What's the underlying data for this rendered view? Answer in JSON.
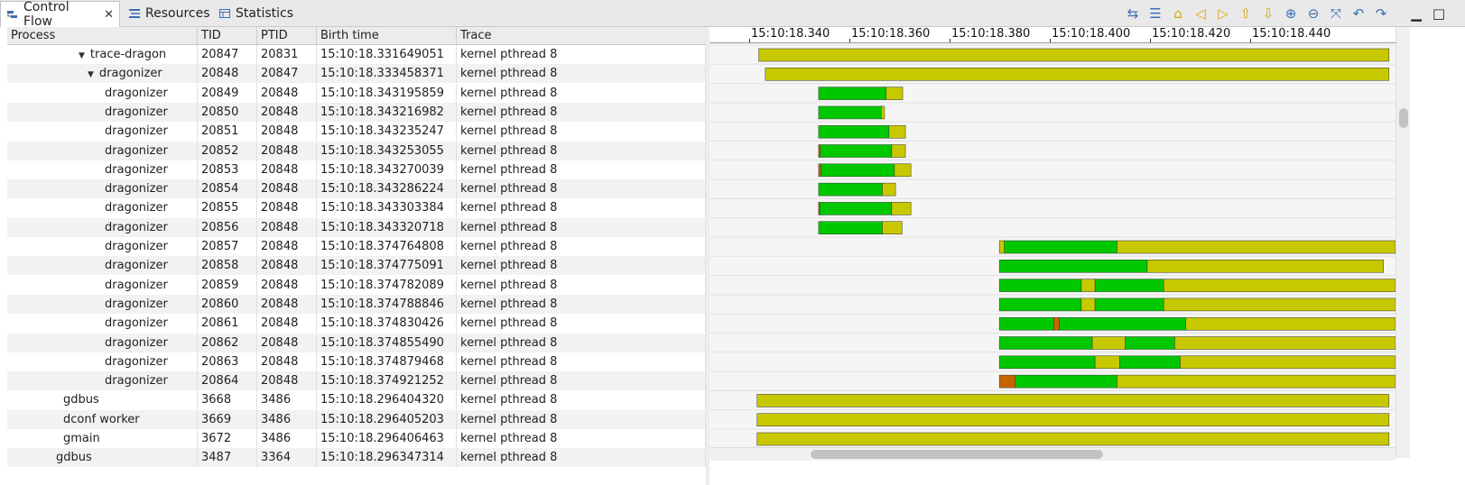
{
  "tabs": [
    {
      "label": "Control Flow",
      "icon": "control-flow-icon",
      "active": true,
      "closable": true
    },
    {
      "label": "Resources",
      "icon": "resources-icon",
      "active": false
    },
    {
      "label": "Statistics",
      "icon": "statistics-icon",
      "active": false
    }
  ],
  "toolbar": [
    "align-views-icon",
    "show-legend-icon",
    "reset-timescale-icon",
    "select-previous-event-icon",
    "select-next-event-icon",
    "previous-process-icon",
    "next-process-icon",
    "zoom-in-icon",
    "zoom-out-icon",
    "hide-arrows-icon",
    "follow-arrow-backward-icon",
    "follow-arrow-forward-icon",
    "minimize-icon",
    "maximize-icon"
  ],
  "table": {
    "headers": [
      "Process",
      "TID",
      "PTID",
      "Birth time",
      "Trace"
    ],
    "rows": [
      {
        "process": "trace-dragon",
        "tid": "20847",
        "ptid": "20831",
        "birth": "15:10:18.331649051",
        "trace": "kernel pthread 8",
        "expander": "▼"
      },
      {
        "process": "dragonizer",
        "tid": "20848",
        "ptid": "20847",
        "birth": "15:10:18.333458371",
        "trace": "kernel pthread 8",
        "expander": "▼"
      },
      {
        "process": "dragonizer",
        "tid": "20849",
        "ptid": "20848",
        "birth": "15:10:18.343195859",
        "trace": "kernel pthread 8",
        "expander": ""
      },
      {
        "process": "dragonizer",
        "tid": "20850",
        "ptid": "20848",
        "birth": "15:10:18.343216982",
        "trace": "kernel pthread 8",
        "expander": ""
      },
      {
        "process": "dragonizer",
        "tid": "20851",
        "ptid": "20848",
        "birth": "15:10:18.343235247",
        "trace": "kernel pthread 8",
        "expander": ""
      },
      {
        "process": "dragonizer",
        "tid": "20852",
        "ptid": "20848",
        "birth": "15:10:18.343253055",
        "trace": "kernel pthread 8",
        "expander": ""
      },
      {
        "process": "dragonizer",
        "tid": "20853",
        "ptid": "20848",
        "birth": "15:10:18.343270039",
        "trace": "kernel pthread 8",
        "expander": ""
      },
      {
        "process": "dragonizer",
        "tid": "20854",
        "ptid": "20848",
        "birth": "15:10:18.343286224",
        "trace": "kernel pthread 8",
        "expander": ""
      },
      {
        "process": "dragonizer",
        "tid": "20855",
        "ptid": "20848",
        "birth": "15:10:18.343303384",
        "trace": "kernel pthread 8",
        "expander": ""
      },
      {
        "process": "dragonizer",
        "tid": "20856",
        "ptid": "20848",
        "birth": "15:10:18.343320718",
        "trace": "kernel pthread 8",
        "expander": ""
      },
      {
        "process": "dragonizer",
        "tid": "20857",
        "ptid": "20848",
        "birth": "15:10:18.374764808",
        "trace": "kernel pthread 8",
        "expander": ""
      },
      {
        "process": "dragonizer",
        "tid": "20858",
        "ptid": "20848",
        "birth": "15:10:18.374775091",
        "trace": "kernel pthread 8",
        "expander": ""
      },
      {
        "process": "dragonizer",
        "tid": "20859",
        "ptid": "20848",
        "birth": "15:10:18.374782089",
        "trace": "kernel pthread 8",
        "expander": ""
      },
      {
        "process": "dragonizer",
        "tid": "20860",
        "ptid": "20848",
        "birth": "15:10:18.374788846",
        "trace": "kernel pthread 8",
        "expander": ""
      },
      {
        "process": "dragonizer",
        "tid": "20861",
        "ptid": "20848",
        "birth": "15:10:18.374830426",
        "trace": "kernel pthread 8",
        "expander": ""
      },
      {
        "process": "dragonizer",
        "tid": "20862",
        "ptid": "20848",
        "birth": "15:10:18.374855490",
        "trace": "kernel pthread 8",
        "expander": ""
      },
      {
        "process": "dragonizer",
        "tid": "20863",
        "ptid": "20848",
        "birth": "15:10:18.374879468",
        "trace": "kernel pthread 8",
        "expander": ""
      },
      {
        "process": "dragonizer",
        "tid": "20864",
        "ptid": "20848",
        "birth": "15:10:18.374921252",
        "trace": "kernel pthread 8",
        "expander": ""
      },
      {
        "process": "gdbus",
        "tid": "3668",
        "ptid": "3486",
        "birth": "15:10:18.296404320",
        "trace": "kernel pthread 8",
        "expander": ""
      },
      {
        "process": "dconf worker",
        "tid": "3669",
        "ptid": "3486",
        "birth": "15:10:18.296405203",
        "trace": "kernel pthread 8",
        "expander": ""
      },
      {
        "process": "gmain",
        "tid": "3672",
        "ptid": "3486",
        "birth": "15:10:18.296406463",
        "trace": "kernel pthread 8",
        "expander": ""
      },
      {
        "process": "gdbus",
        "tid": "3487",
        "ptid": "3364",
        "birth": "15:10:18.296347314",
        "trace": "kernel pthread 8",
        "expander": ""
      }
    ]
  },
  "timescale": {
    "ticks": [
      "15:10:18.340",
      "15:10:18.360",
      "15:10:18.380",
      "15:10:18.400",
      "15:10:18.420",
      "15:10:18.440"
    ]
  },
  "state_colors": {
    "running": "#00c800",
    "wait": "#c8c800",
    "blocked": "#c86400",
    "unknown": "#0000ff"
  },
  "gantt": {
    "rows": [
      [
        [
          "wait",
          0.3313,
          0.446
        ]
      ],
      [
        [
          "wait",
          0.3325,
          0.446
        ]
      ],
      [
        [
          "running",
          0.3422,
          0.3545
        ],
        [
          "wait",
          0.3545,
          0.3575
        ]
      ],
      [
        [
          "running",
          0.3422,
          0.3536
        ],
        [
          "wait",
          0.3536,
          0.3542
        ]
      ],
      [
        [
          "running",
          0.3422,
          0.355
        ],
        [
          "wait",
          0.355,
          0.358
        ]
      ],
      [
        [
          "blocked",
          0.3422,
          0.3425
        ],
        [
          "running",
          0.3425,
          0.3555
        ],
        [
          "wait",
          0.3555,
          0.358
        ]
      ],
      [
        [
          "blocked",
          0.3422,
          0.3426
        ],
        [
          "running",
          0.3426,
          0.356
        ],
        [
          "wait",
          0.356,
          0.359
        ]
      ],
      [
        [
          "running",
          0.3422,
          0.3538
        ],
        [
          "wait",
          0.3538,
          0.3562
        ]
      ],
      [
        [
          "blocked",
          0.3422,
          0.3424
        ],
        [
          "running",
          0.3424,
          0.3555
        ],
        [
          "wait",
          0.3555,
          0.359
        ]
      ],
      [
        [
          "running",
          0.3422,
          0.3538
        ],
        [
          "wait",
          0.3538,
          0.3574
        ]
      ],
      [
        [
          "wait",
          0.3751,
          0.376
        ],
        [
          "running",
          0.376,
          0.3965
        ],
        [
          "wait",
          0.3965,
          0.451
        ]
      ],
      [
        [
          "running",
          0.3751,
          0.402
        ],
        [
          "wait",
          0.402,
          0.445
        ]
      ],
      [
        [
          "running",
          0.3751,
          0.39
        ],
        [
          "wait",
          0.39,
          0.3925
        ],
        [
          "running",
          0.3925,
          0.405
        ],
        [
          "wait",
          0.405,
          0.452
        ]
      ],
      [
        [
          "running",
          0.3751,
          0.39
        ],
        [
          "wait",
          0.39,
          0.3925
        ],
        [
          "running",
          0.3925,
          0.405
        ],
        [
          "wait",
          0.405,
          0.448
        ]
      ],
      [
        [
          "running",
          0.3751,
          0.385
        ],
        [
          "blocked",
          0.385,
          0.386
        ],
        [
          "running",
          0.386,
          0.409
        ],
        [
          "wait",
          0.409,
          0.448
        ]
      ],
      [
        [
          "running",
          0.3751,
          0.392
        ],
        [
          "wait",
          0.392,
          0.398
        ],
        [
          "running",
          0.398,
          0.407
        ],
        [
          "wait",
          0.407,
          0.452
        ]
      ],
      [
        [
          "running",
          0.3751,
          0.3925
        ],
        [
          "wait",
          0.3925,
          0.397
        ],
        [
          "running",
          0.397,
          0.408
        ],
        [
          "wait",
          0.408,
          0.45
        ]
      ],
      [
        [
          "blocked",
          0.3751,
          0.378
        ],
        [
          "running",
          0.378,
          0.3965
        ],
        [
          "wait",
          0.3965,
          0.451
        ]
      ],
      [
        [
          "wait",
          0.331,
          0.446
        ]
      ],
      [
        [
          "wait",
          0.331,
          0.446
        ]
      ],
      [
        [
          "wait",
          0.331,
          0.446
        ]
      ],
      [
        [
          "wait",
          0.331,
          0.446
        ]
      ]
    ]
  }
}
